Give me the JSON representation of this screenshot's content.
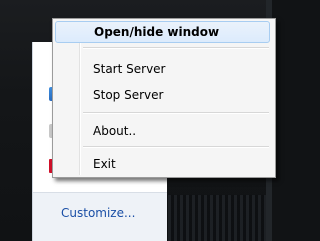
{
  "context_menu": {
    "items": [
      {
        "label": "Open/hide window",
        "bold": true,
        "highlighted": true
      },
      {
        "label": "Start Server"
      },
      {
        "label": "Stop Server"
      },
      {
        "label": "About.."
      },
      {
        "label": "Exit"
      }
    ]
  },
  "tray_panel": {
    "customize_label": "Customize...",
    "icons": [
      "app-icon-blue",
      "app-icon-gray",
      "app-icon-red"
    ]
  },
  "colors": {
    "menu_highlight": "#dcebfc",
    "link": "#1a4fa6"
  }
}
